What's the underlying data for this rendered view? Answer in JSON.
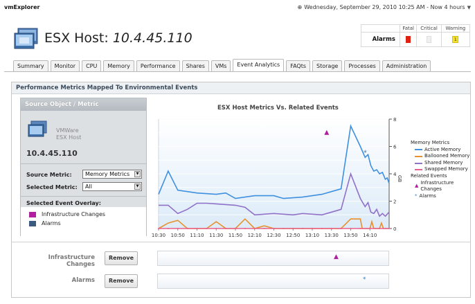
{
  "app": {
    "title": "vmExplorer"
  },
  "header": {
    "datetime": "Wednesday, September 29, 2010 10:25 AM - Now 4 hours",
    "host_label": "ESX Host:",
    "host_ip": "10.4.45.110"
  },
  "alarms": {
    "label": "Alarms",
    "columns": [
      "Fatal",
      "Critical",
      "Warning"
    ],
    "warning_count": "1",
    "colors": {
      "fatal": "#e02010",
      "warning": "#f6e233"
    }
  },
  "tabs": [
    "Summary",
    "Monitor",
    "CPU",
    "Memory",
    "Performance",
    "Shares",
    "VMs",
    "Event Analytics",
    "FAQts",
    "Storage",
    "Processes",
    "Administration"
  ],
  "active_tab": "Event Analytics",
  "panel": {
    "title": "Performance Metrics Mapped To Environmental Events",
    "source": {
      "header": "Source Object / Metric",
      "vm_type_line1": "VMWare",
      "vm_type_line2": "ESX Host",
      "host_ip": "10.4.45.110",
      "source_metric_label": "Source Metric:",
      "source_metric_value": "Memory Metrics",
      "selected_metric_label": "Selected Metric:",
      "selected_metric_value": "All",
      "overlay_title": "Selected Event Overlay:",
      "overlays": [
        {
          "label": "Infrastructure Changes",
          "color": "#b01f9e"
        },
        {
          "label": "Alarms",
          "color": "#3c5a80"
        }
      ]
    },
    "remove_rows": [
      {
        "label": "Infrastructure Changes",
        "button": "Remove",
        "marker": "▲",
        "marker_color": "#b01f9e"
      },
      {
        "label": "Alarms",
        "button": "Remove",
        "marker": "*",
        "marker_color": "#3a7ab8"
      }
    ]
  },
  "chart_data": {
    "type": "line",
    "title": "ESX Host Metrics Vs. Related Events",
    "ylabel": "GB",
    "ylim": [
      0,
      8
    ],
    "yticks": [
      "0",
      "2",
      "4",
      "6",
      "8"
    ],
    "x_ticks": [
      "10:30",
      "10:50",
      "11:10",
      "11:30",
      "11:50",
      "12:10",
      "12:30",
      "12:50",
      "13:10",
      "13:30",
      "13:50",
      "14:10"
    ],
    "x_minutes": {
      "start": 630,
      "end": 870
    },
    "legend": {
      "heading": "Memory Metrics",
      "events_heading": "Related Events",
      "position": "right"
    },
    "series": [
      {
        "name": "Active Memory",
        "color": "#3d8fe0",
        "points": [
          [
            630,
            2.5
          ],
          [
            640,
            4.2
          ],
          [
            650,
            2.8
          ],
          [
            670,
            2.6
          ],
          [
            690,
            2.5
          ],
          [
            700,
            2.6
          ],
          [
            710,
            2.2
          ],
          [
            730,
            2.4
          ],
          [
            750,
            2.4
          ],
          [
            760,
            2.2
          ],
          [
            780,
            2.3
          ],
          [
            800,
            2.5
          ],
          [
            820,
            2.9
          ],
          [
            830,
            7.5
          ],
          [
            840,
            6.0
          ],
          [
            845,
            5.2
          ],
          [
            848,
            5.4
          ],
          [
            851,
            4.6
          ],
          [
            854,
            4.2
          ],
          [
            857,
            4.3
          ],
          [
            860,
            4.0
          ],
          [
            863,
            4.1
          ],
          [
            866,
            3.6
          ],
          [
            868,
            3.7
          ],
          [
            870,
            3.3
          ]
        ]
      },
      {
        "name": "Ballooned Memory",
        "color": "#e8902a",
        "points": [
          [
            630,
            0
          ],
          [
            640,
            0.4
          ],
          [
            650,
            0.6
          ],
          [
            660,
            0
          ],
          [
            680,
            0
          ],
          [
            690,
            0.5
          ],
          [
            700,
            0
          ],
          [
            710,
            0
          ],
          [
            720,
            0.7
          ],
          [
            730,
            0
          ],
          [
            740,
            0.2
          ],
          [
            750,
            0
          ],
          [
            820,
            0
          ],
          [
            830,
            0.7
          ],
          [
            840,
            0.7
          ],
          [
            842,
            0
          ],
          [
            850,
            0
          ],
          [
            852,
            0.5
          ],
          [
            854,
            0
          ],
          [
            860,
            0
          ],
          [
            862,
            0.4
          ],
          [
            864,
            0
          ],
          [
            870,
            0
          ]
        ]
      },
      {
        "name": "Shared Memory",
        "color": "#9070c8",
        "points": [
          [
            630,
            1.7
          ],
          [
            640,
            1.7
          ],
          [
            650,
            1.1
          ],
          [
            660,
            1.4
          ],
          [
            670,
            1.85
          ],
          [
            680,
            1.85
          ],
          [
            690,
            1.8
          ],
          [
            700,
            1.75
          ],
          [
            710,
            1.7
          ],
          [
            720,
            1.55
          ],
          [
            730,
            1.0
          ],
          [
            750,
            1.1
          ],
          [
            770,
            1.0
          ],
          [
            780,
            1.1
          ],
          [
            800,
            1.0
          ],
          [
            810,
            1.2
          ],
          [
            820,
            1.4
          ],
          [
            830,
            4.0
          ],
          [
            840,
            2.2
          ],
          [
            845,
            1.6
          ],
          [
            848,
            1.9
          ],
          [
            851,
            1.2
          ],
          [
            854,
            1.1
          ],
          [
            857,
            1.4
          ],
          [
            860,
            0.9
          ],
          [
            863,
            1.1
          ],
          [
            866,
            0.9
          ],
          [
            870,
            1.2
          ]
        ]
      },
      {
        "name": "Swapped Memory",
        "color": "#e8608a",
        "points": [
          [
            630,
            0
          ],
          [
            870,
            0
          ]
        ]
      }
    ],
    "events": [
      {
        "name": "Infrastructure Changes",
        "color": "#b01f9e",
        "marker": "triangle",
        "points": [
          [
            805,
            7.0
          ]
        ]
      },
      {
        "name": "Alarms",
        "color": "#3a7ab8",
        "marker": "star",
        "points": [
          [
            845,
            5.6
          ]
        ]
      }
    ]
  }
}
